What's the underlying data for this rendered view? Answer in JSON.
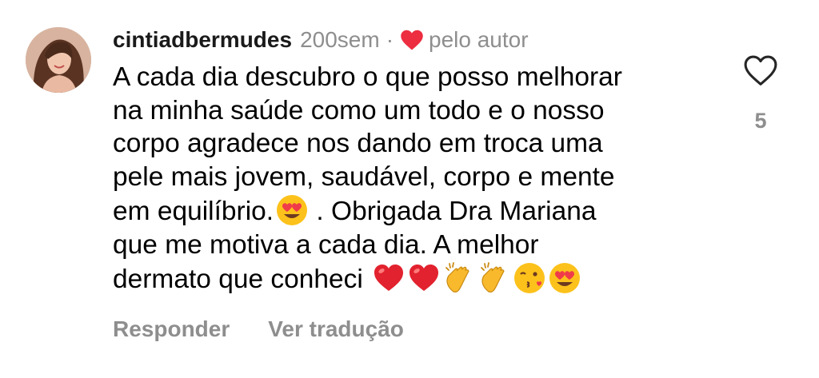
{
  "comment": {
    "username": "cintiadbermudes",
    "time": "200sem",
    "separator": "·",
    "author_like_label": "pelo autor",
    "lines": [
      "A cada dia descubro o que posso melhorar",
      "na minha saúde como um todo e o nosso",
      "corpo agradece nos dando em troca uma",
      "pele mais jovem, saudável, corpo e mente",
      "em equilíbrio.",
      " . Obrigada Dra Mariana",
      "que me motiva a cada dia. A melhor",
      "dermato que conheci"
    ],
    "emojis_line5": [
      "heart-eyes-emoji"
    ],
    "emojis_line8": [
      "red-heart-emoji",
      "red-heart-emoji",
      "clapping-hands-emoji",
      "clapping-hands-emoji",
      "kissing-face-emoji",
      "heart-eyes-emoji"
    ],
    "like_count": "5"
  },
  "actions": {
    "reply_label": "Responder",
    "translate_label": "Ver tradução"
  },
  "colors": {
    "heart_red": "#ed2d40",
    "muted_gray": "#8e8e8e",
    "text": "#000000"
  },
  "icons": {
    "like": "heart-outline-icon",
    "author_like": "heart-filled-icon"
  }
}
